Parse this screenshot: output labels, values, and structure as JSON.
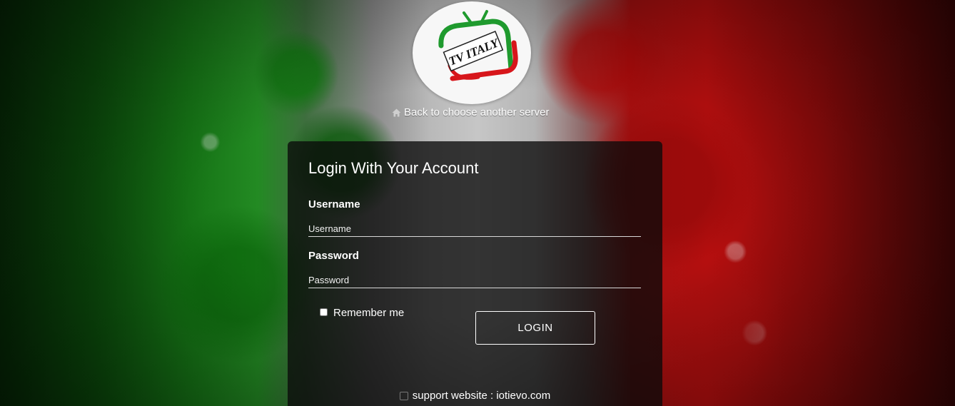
{
  "logo": {
    "text": "TV ITALY",
    "icon": "tv-italy-logo-icon",
    "colors": {
      "green": "#1f9a2e",
      "red": "#d7161b"
    }
  },
  "back_link": {
    "icon": "home-icon",
    "label": "Back to choose another server"
  },
  "login_panel": {
    "title": "Login With Your Account",
    "username": {
      "label": "Username",
      "placeholder": "Username",
      "value": ""
    },
    "password": {
      "label": "Password",
      "placeholder": "Password",
      "value": ""
    },
    "remember": {
      "label": "Remember me",
      "checked": false
    },
    "submit_label": "LOGIN"
  },
  "footer": {
    "icon": "support-icon",
    "text": "support website : iotievo.com"
  },
  "theme": {
    "accent": "#ffffff",
    "panel_background": "#0a0a0a"
  }
}
